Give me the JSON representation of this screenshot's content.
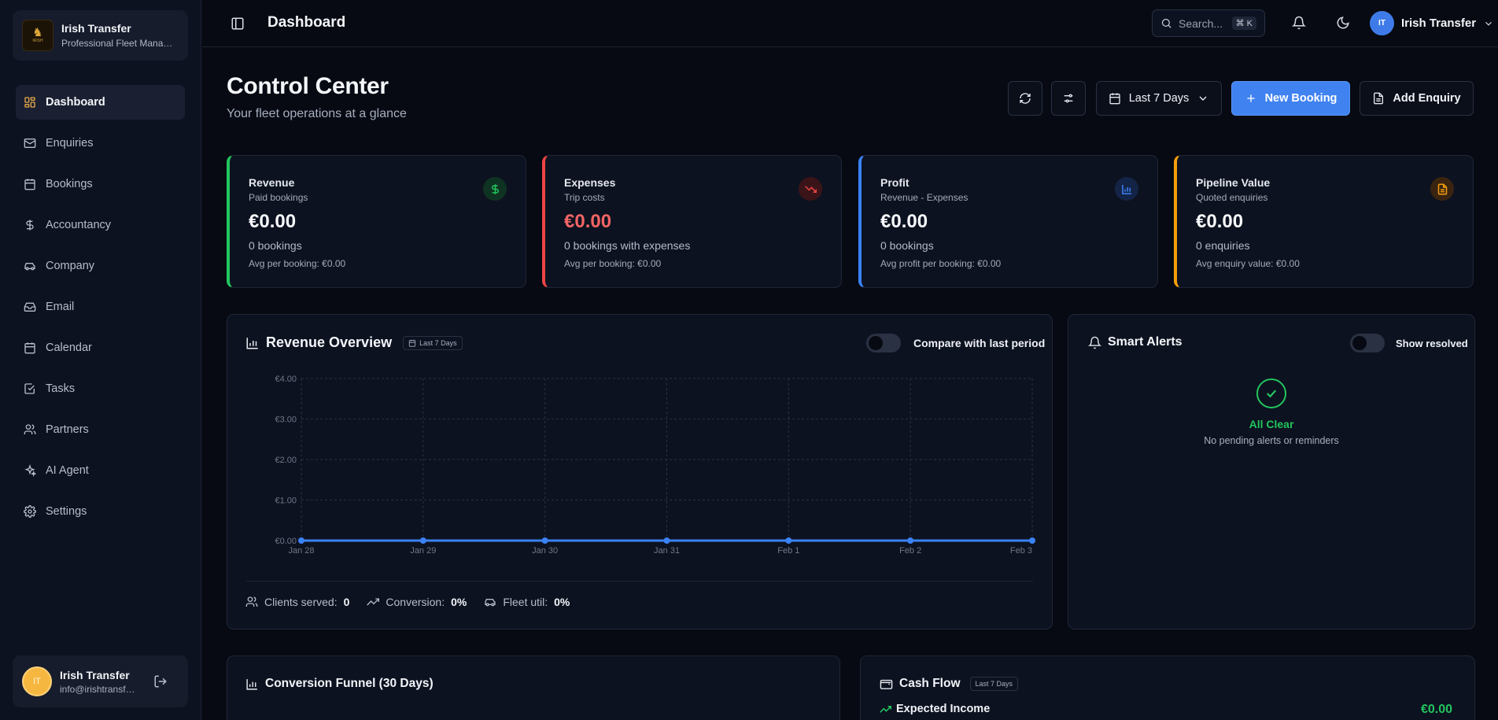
{
  "brand": {
    "name": "Irish Transfer",
    "tagline": "Professional Fleet Management",
    "logo_text": "IRISH"
  },
  "sidebar": {
    "items": [
      {
        "label": "Dashboard",
        "icon": "dashboard-icon",
        "active": true
      },
      {
        "label": "Enquiries",
        "icon": "mail-icon"
      },
      {
        "label": "Bookings",
        "icon": "calendar-icon"
      },
      {
        "label": "Accountancy",
        "icon": "dollar-icon"
      },
      {
        "label": "Company",
        "icon": "car-icon"
      },
      {
        "label": "Email",
        "icon": "inbox-icon"
      },
      {
        "label": "Calendar",
        "icon": "calendar-icon"
      },
      {
        "label": "Tasks",
        "icon": "check-square-icon"
      },
      {
        "label": "Partners",
        "icon": "users-icon"
      },
      {
        "label": "AI Agent",
        "icon": "sparkles-icon"
      },
      {
        "label": "Settings",
        "icon": "gear-icon"
      }
    ],
    "user": {
      "initials": "IT",
      "name": "Irish Transfer",
      "email": "info@irishtransfers.com"
    }
  },
  "topbar": {
    "title": "Dashboard",
    "search_placeholder": "Search...",
    "search_shortcut": "⌘ K",
    "user_initials": "IT",
    "user_name": "Irish Transfer"
  },
  "header": {
    "title": "Control Center",
    "subtitle": "Your fleet operations at a glance",
    "range_label": "Last 7 Days",
    "new_booking_label": "New Booking",
    "add_enquiry_label": "Add Enquiry"
  },
  "kpis": [
    {
      "title": "Revenue",
      "subtitle": "Paid bookings",
      "value": "€0.00",
      "count": "0 bookings",
      "avg": "Avg per booking: €0.00",
      "accent": "#22c55e",
      "icon": "dollar-icon"
    },
    {
      "title": "Expenses",
      "subtitle": "Trip costs",
      "value": "€0.00",
      "count": "0 bookings with expenses",
      "avg": "Avg per booking: €0.00",
      "accent": "#ef4444",
      "icon": "trending-down-icon"
    },
    {
      "title": "Profit",
      "subtitle": "Revenue - Expenses",
      "value": "€0.00",
      "count": "0 bookings",
      "avg": "Avg profit per booking: €0.00",
      "accent": "#3b82f6",
      "icon": "bar-chart-icon"
    },
    {
      "title": "Pipeline Value",
      "subtitle": "Quoted enquiries",
      "value": "€0.00",
      "count": "0 enquiries",
      "avg": "Avg enquiry value: €0.00",
      "accent": "#f59e0b",
      "icon": "document-icon"
    }
  ],
  "revenue_panel": {
    "title": "Revenue Overview",
    "range_chip": "Last 7 Days",
    "compare_label": "Compare with last period",
    "stats": {
      "clients_label": "Clients served:",
      "clients_value": "0",
      "conversion_label": "Conversion:",
      "conversion_value": "0%",
      "fleet_label": "Fleet util:",
      "fleet_value": "0%"
    }
  },
  "chart_data": {
    "type": "line",
    "x": [
      "Jan 28",
      "Jan 29",
      "Jan 30",
      "Jan 31",
      "Feb 1",
      "Feb 2",
      "Feb 3"
    ],
    "series": [
      {
        "values": [
          0,
          0,
          0,
          0,
          0,
          0,
          0
        ]
      }
    ],
    "ylim": [
      0,
      4
    ],
    "yticks": [
      "€0.00",
      "€1.00",
      "€2.00",
      "€3.00",
      "€4.00"
    ],
    "grid": true,
    "color": "#3b82f6"
  },
  "alerts_panel": {
    "title": "Smart Alerts",
    "toggle_label": "Show resolved",
    "status_title": "All Clear",
    "status_text": "No pending alerts or reminders"
  },
  "funnel_panel": {
    "title": "Conversion Funnel (30 Days)"
  },
  "cashflow_panel": {
    "title": "Cash Flow",
    "range_chip": "Last 7 Days",
    "income_label": "Expected Income",
    "income_value": "€0.00"
  }
}
